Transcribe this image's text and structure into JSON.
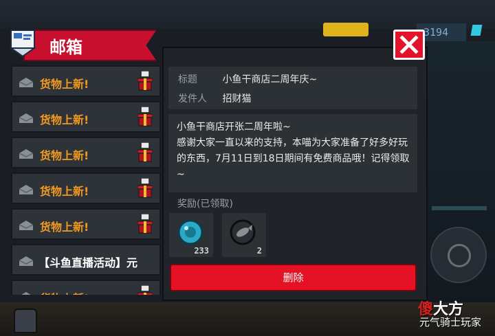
{
  "hud": {
    "counter": "3194"
  },
  "mailbox": {
    "title": "邮箱"
  },
  "mail_items": [
    {
      "label": "货物上新!",
      "style": "unread-gift"
    },
    {
      "label": "货物上新!",
      "style": "unread-gift"
    },
    {
      "label": "货物上新!",
      "style": "unread-gift"
    },
    {
      "label": "货物上新!",
      "style": "unread-gift"
    },
    {
      "label": "货物上新!",
      "style": "unread-gift"
    },
    {
      "label": "【斗鱼直播活动】元",
      "style": "plain"
    },
    {
      "label": "货物上新!",
      "style": "unread-gift"
    }
  ],
  "detail": {
    "title_label": "标题",
    "title_value": "小鱼干商店二周年庆~",
    "sender_label": "发件人",
    "sender_value": "招财猫",
    "message": "小鱼干商店开张二周年啦~\n感谢大家一直以来的支持，本喵为大家准备了好多好玩的东西，7月11日到18日期间有免费商品哦！记得领取~",
    "rewards_label": "奖励(已领取)",
    "rewards": [
      {
        "icon": "blue-gem-icon",
        "quantity": "233"
      },
      {
        "icon": "fish-coin-icon",
        "quantity": "2"
      }
    ],
    "delete_label": "删除"
  },
  "watermark": {
    "text_red": "傻",
    "text_dark": "大方"
  },
  "bottom_text": "元气骑士玩家",
  "colors": {
    "accent_red": "#e51124",
    "item_label_orange": "#f39a1e",
    "panel": "#202429"
  }
}
